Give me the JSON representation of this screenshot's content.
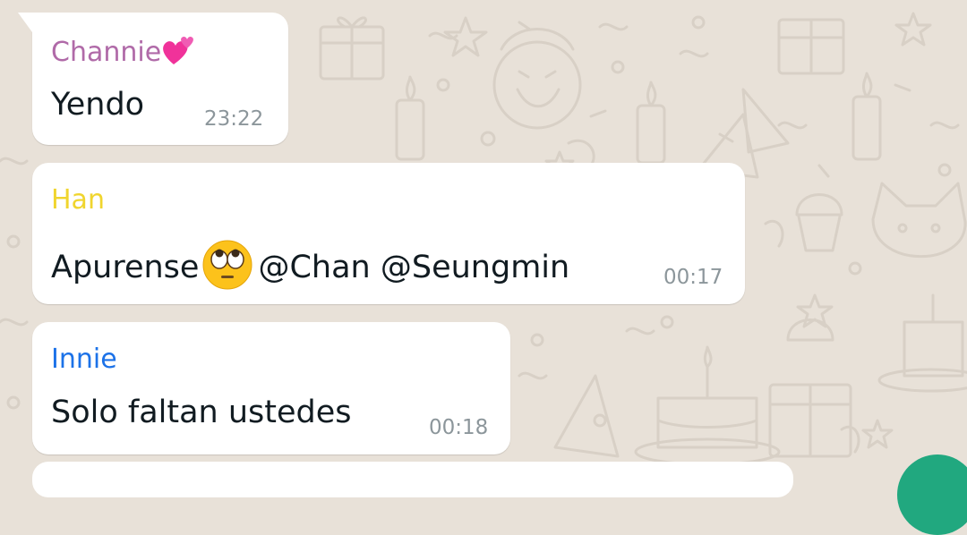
{
  "colors": {
    "background": "#e8e1d8",
    "bubble": "#ffffff",
    "timestamp": "#8c969b",
    "fab": "#21a87f"
  },
  "messages": [
    {
      "sender": "Channie",
      "sender_color": "#b06aa8",
      "sender_emoji": "two-hearts-icon",
      "text": "Yendo",
      "time": "23:22"
    },
    {
      "sender": "Han",
      "sender_color": "#f0d52e",
      "text_before_emoji": "Apurense",
      "emoji": "face-with-rolling-eyes-icon",
      "mention_1": "@Chan",
      "mention_2": "@Seungmin",
      "time": "00:17"
    },
    {
      "sender": "Innie",
      "sender_color": "#1c72e8",
      "text": "Solo faltan ustedes",
      "time": "00:18"
    }
  ]
}
